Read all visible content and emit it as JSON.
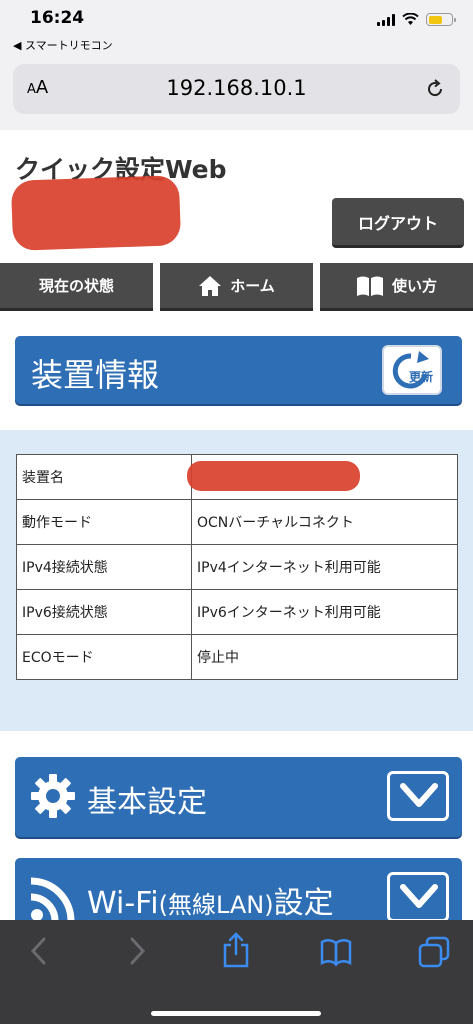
{
  "status_bar": {
    "time": "16:24",
    "back_app": "◀ スマートリモコン"
  },
  "browser": {
    "aa_label": "AA",
    "url": "192.168.10.1"
  },
  "page": {
    "title": "クイック設定Web",
    "logout_label": "ログアウト"
  },
  "nav": [
    {
      "label": "現在の状態",
      "icon": ""
    },
    {
      "label": "ホーム",
      "icon": "home-icon"
    },
    {
      "label": "使い方",
      "icon": "book-icon"
    }
  ],
  "device_info": {
    "title": "装置情報",
    "refresh_label": "更新",
    "rows": [
      {
        "key": "装置名",
        "value": ""
      },
      {
        "key": "動作モード",
        "value": "OCNバーチャルコネクト"
      },
      {
        "key": "IPv4接続状態",
        "value": "IPv4インターネット利用可能"
      },
      {
        "key": "IPv6接続状態",
        "value": "IPv6インターネット利用可能"
      },
      {
        "key": "ECOモード",
        "value": "停止中"
      }
    ]
  },
  "sections": [
    {
      "title": "基本設定",
      "icon": "gear-icon"
    },
    {
      "title_main": "Wi-Fi",
      "title_paren": "(無線LAN)",
      "title_tail": "設定",
      "icon": "wifi-icon"
    }
  ],
  "colors": {
    "accent_blue": "#2e6eb5",
    "nav_gray": "#4a4a4a",
    "panel_bg": "#dce9f7",
    "redaction": "#d9402c",
    "toolbar_dark": "#3a3a3c"
  }
}
